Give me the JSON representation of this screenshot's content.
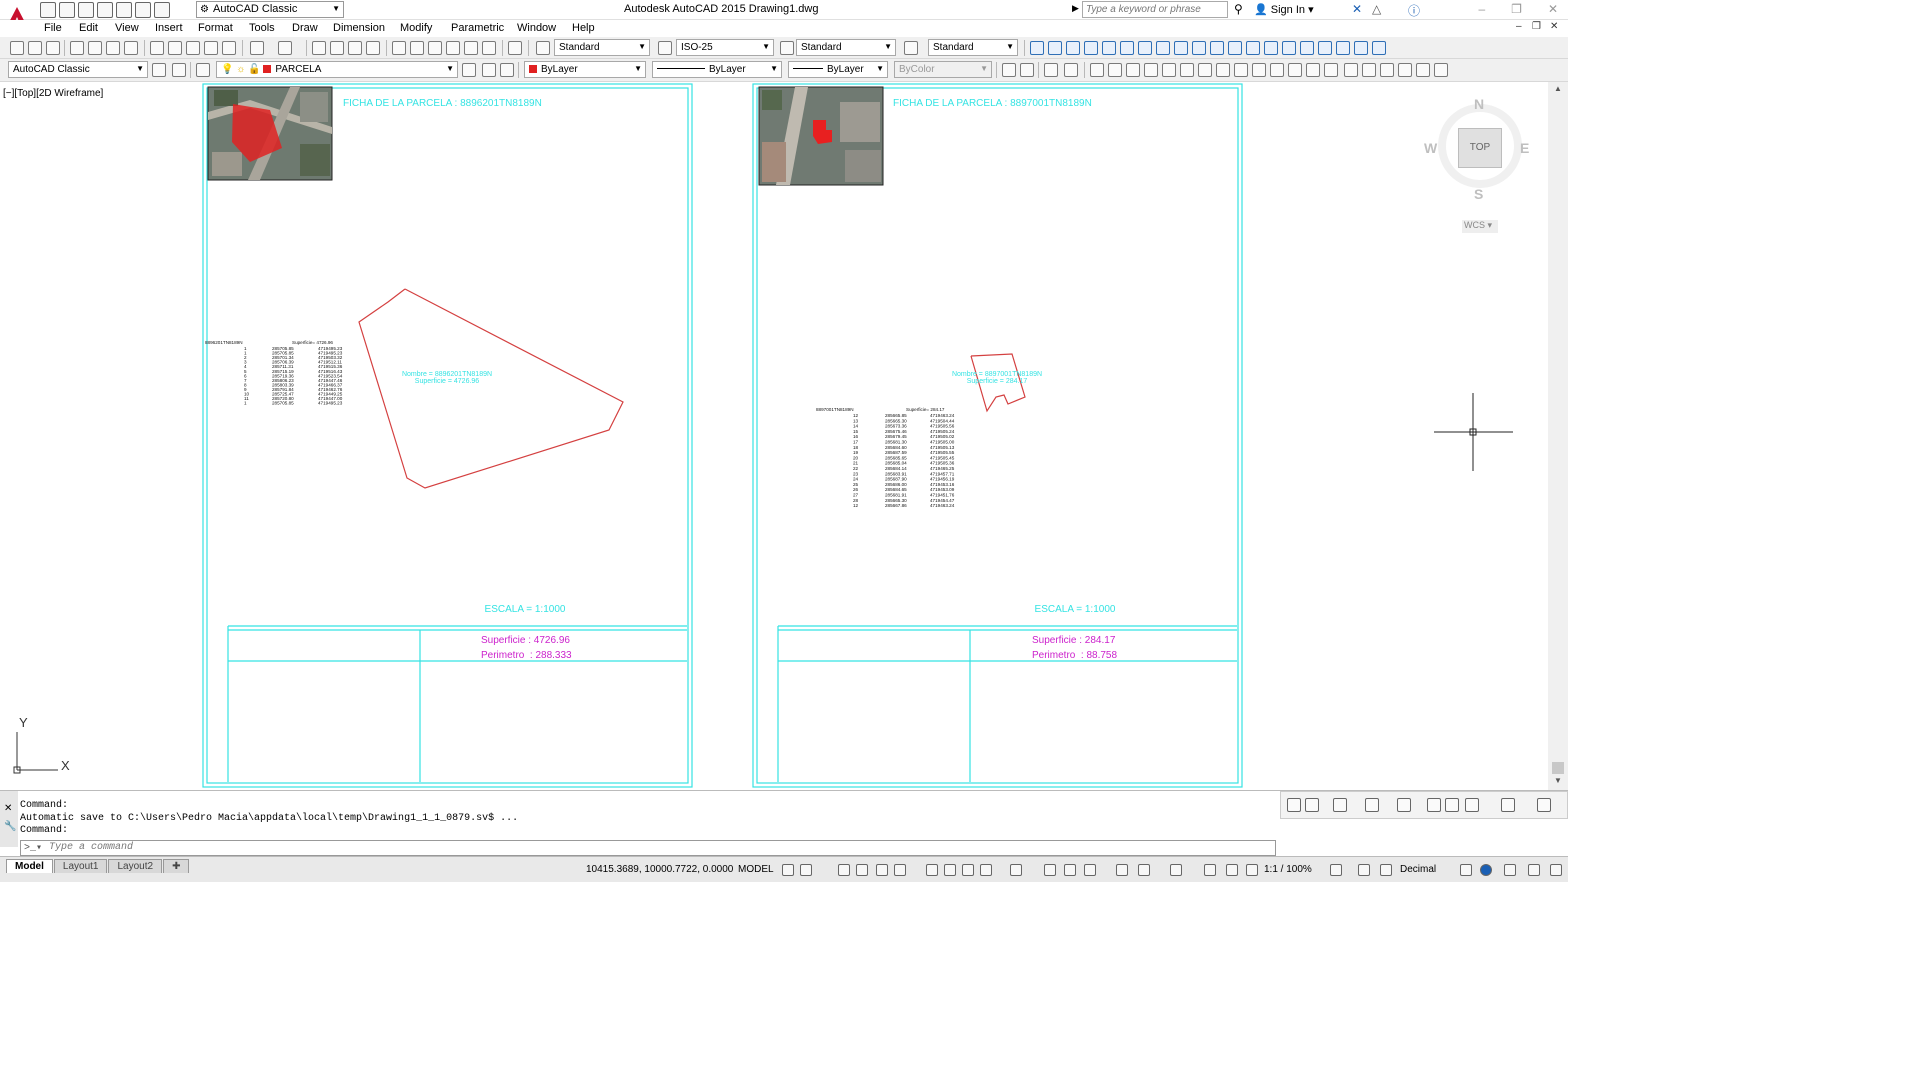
{
  "app": {
    "title": "Autodesk AutoCAD 2015    Drawing1.dwg",
    "workspace": "AutoCAD Classic",
    "search_placeholder": "Type a keyword or phrase",
    "signin": "Sign In"
  },
  "menu": [
    "File",
    "Edit",
    "View",
    "Insert",
    "Format",
    "Tools",
    "Draw",
    "Dimension",
    "Modify",
    "Parametric",
    "Window",
    "Help"
  ],
  "toolbar": {
    "text_style": "Standard",
    "dim_style": "ISO-25",
    "table_style": "Standard",
    "multileader_style": "Standard",
    "workspace_combo": "AutoCAD Classic",
    "layer": "PARCELA",
    "color": "ByLayer",
    "linetype": "ByLayer",
    "lineweight": "ByLayer",
    "plotstyle": "ByColor"
  },
  "viewport": {
    "label": "[−][Top][2D Wireframe]",
    "axis_x": "X",
    "axis_y": "Y"
  },
  "viewcube": {
    "top": "TOP",
    "n": "N",
    "s": "S",
    "e": "E",
    "w": "W",
    "wcs": "WCS"
  },
  "sheets": [
    {
      "title": "FICHA DE LA PARCELA : 8896201TN8189N",
      "scale": "ESCALA =  1:1000",
      "superficie": "Superficie : 4726.96",
      "perimetro": "Perimetro  : 288.333",
      "plot_label_name": "Nombre = 8896201TN8189N",
      "plot_label_area": "Superficie = 4726.96",
      "table_header_id": "8896201TN8189N",
      "table_header_area": "Superficie=    4726.96",
      "rows": [
        [
          "1",
          "285705.85",
          "4719495.23"
        ],
        [
          "1",
          "285705.85",
          "4719495.23"
        ],
        [
          "2",
          "285701.34",
          "4719503.32"
        ],
        [
          "3",
          "285706.39",
          "4719512.11"
        ],
        [
          "4",
          "285711.31",
          "4719515.36"
        ],
        [
          "5",
          "285715.19",
          "4719516.43"
        ],
        [
          "6",
          "285719.36",
          "4719523.54"
        ],
        [
          "7",
          "285806.23",
          "4719447.46"
        ],
        [
          "8",
          "285803.39",
          "4719466.37"
        ],
        [
          "9",
          "285791.84",
          "4719462.76"
        ],
        [
          "10",
          "285725.47",
          "4719449.25"
        ],
        [
          "11",
          "285720.80",
          "4719447.00"
        ],
        [
          "1",
          "285705.85",
          "4719495.23"
        ]
      ]
    },
    {
      "title": "FICHA DE LA PARCELA : 8897001TN8189N",
      "scale": "ESCALA =  1:1000",
      "superficie": "Superficie : 284.17",
      "perimetro": "Perimetro  : 88.758",
      "plot_label_name": "Nombre = 8897001TN8189N",
      "plot_label_area": "Superficie = 284.17",
      "table_header_id": "8897001TN8189N",
      "table_header_area": "Superficie=    284.17",
      "rows": [
        [
          "12",
          "285665.85",
          "4719463.24"
        ],
        [
          "13",
          "285665.30",
          "4719504.44"
        ],
        [
          "14",
          "285673.36",
          "4719505.56"
        ],
        [
          "15",
          "285675.46",
          "4719505.24"
        ],
        [
          "16",
          "285679.45",
          "4719505.02"
        ],
        [
          "17",
          "285681.30",
          "4719505.00"
        ],
        [
          "18",
          "285684.60",
          "4719505.13"
        ],
        [
          "19",
          "285687.59",
          "4719505.55"
        ],
        [
          "20",
          "285685.65",
          "4719505.45"
        ],
        [
          "21",
          "285685.04",
          "4719505.36"
        ],
        [
          "22",
          "285684.14",
          "4719465.25"
        ],
        [
          "23",
          "285683.91",
          "4719457.71"
        ],
        [
          "24",
          "285687.90",
          "4719456.19"
        ],
        [
          "25",
          "285686.00",
          "4719453.16"
        ],
        [
          "26",
          "285684.65",
          "4719453.09"
        ],
        [
          "27",
          "285681.91",
          "4719451.76"
        ],
        [
          "28",
          "285665.30",
          "4719454.47"
        ],
        [
          "12",
          "285667.86",
          "4719463.24"
        ]
      ]
    }
  ],
  "command": {
    "history": [
      "Command:",
      "Automatic save to C:\\Users\\Pedro Macia\\appdata\\local\\temp\\Drawing1_1_1_0879.sv$ ...",
      "Command:"
    ],
    "placeholder": "Type a command"
  },
  "status": {
    "tabs": [
      "Model",
      "Layout1",
      "Layout2"
    ],
    "coords": "10415.3689, 10000.7722, 0.0000",
    "space": "MODEL",
    "annotation_scale": "1:1 / 100%",
    "units": "Decimal"
  },
  "colors": {
    "cyan": "#35e3e3",
    "magenta": "#cc22cc",
    "red": "#d44040",
    "autocad_red": "#c8102e"
  }
}
